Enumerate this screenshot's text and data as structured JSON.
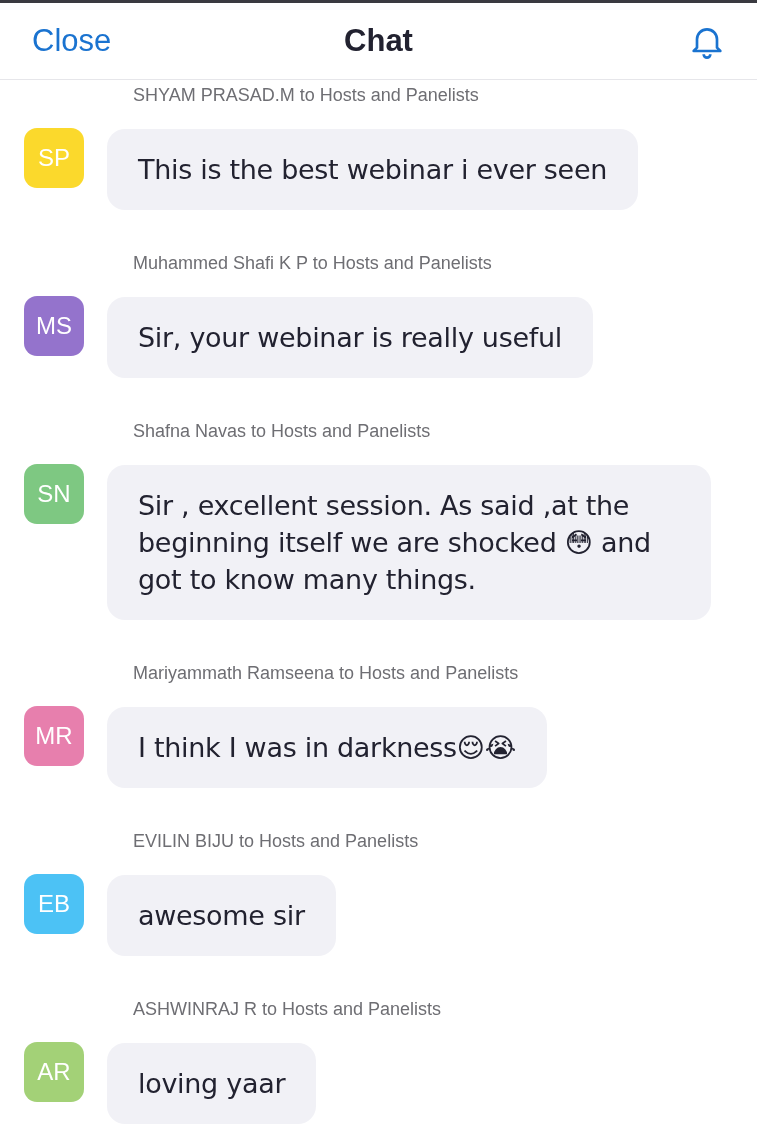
{
  "header": {
    "close": "Close",
    "title": "Chat"
  },
  "messages": [
    {
      "sender": "SHYAM PRASAD.M to Hosts and Panelists",
      "initials": "SP",
      "color": "#fbd92c",
      "text": "This is the best webinar i ever seen"
    },
    {
      "sender": "Muhammed Shafi K P to Hosts and Panelists",
      "initials": "MS",
      "color": "#9473cc",
      "text": "Sir, your webinar is really useful"
    },
    {
      "sender": "Shafna Navas to Hosts and Panelists",
      "initials": "SN",
      "color": "#7ec882",
      "text": "Sir , excellent session. As said ,at the beginning itself we are shocked 😳 and got to know many things."
    },
    {
      "sender": "Mariyammath Ramseena to Hosts and Panelists",
      "initials": "MR",
      "color": "#e77fad",
      "text": "I think I was in darkness😌😭"
    },
    {
      "sender": "EVILIN BIJU to Hosts and Panelists",
      "initials": "EB",
      "color": "#4cc2f5",
      "text": "awesome sir"
    },
    {
      "sender": "ASHWINRAJ R to Hosts and Panelists",
      "initials": "AR",
      "color": "#a3d177",
      "text": "loving yaar"
    }
  ]
}
